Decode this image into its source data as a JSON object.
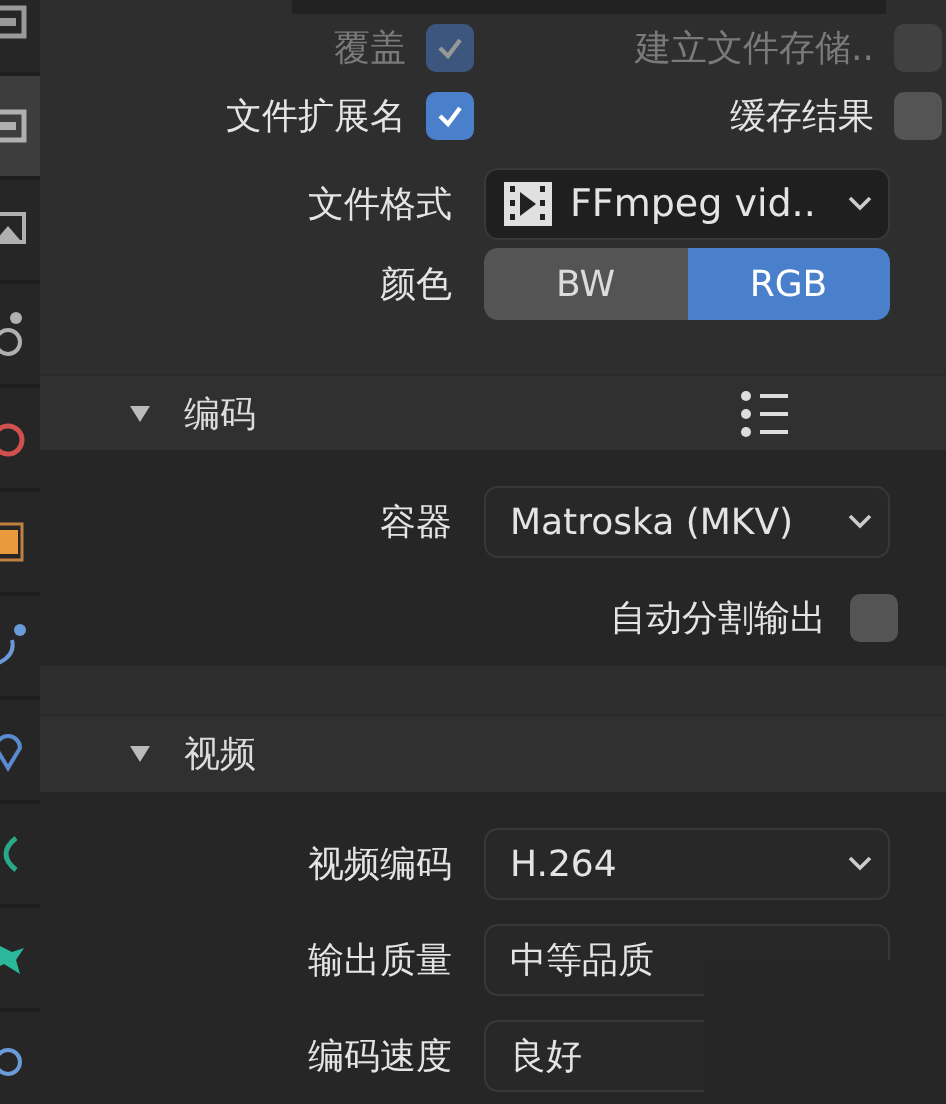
{
  "sidebar_tabs": [
    {
      "selected": false
    },
    {
      "selected": true
    },
    {
      "selected": false
    },
    {
      "selected": false
    },
    {
      "selected": false
    },
    {
      "selected": false
    },
    {
      "selected": false
    },
    {
      "selected": false
    },
    {
      "selected": false
    },
    {
      "selected": false
    },
    {
      "selected": false
    }
  ],
  "checkbox_rows": [
    [
      {
        "label": "覆盖",
        "checked": true,
        "disabled": true
      },
      {
        "label": "建立文件存储..",
        "checked": false,
        "disabled": true
      }
    ],
    [
      {
        "label": "文件扩展名",
        "checked": true,
        "disabled": false
      },
      {
        "label": "缓存结果",
        "checked": false,
        "disabled": false
      }
    ]
  ],
  "file_format": {
    "label": "文件格式",
    "value": "FFmpeg vid.."
  },
  "color": {
    "label": "颜色",
    "options": [
      {
        "label": "BW",
        "selected": false
      },
      {
        "label": "RGB",
        "selected": true
      }
    ]
  },
  "sections": [
    {
      "title": "编码",
      "expanded": true,
      "presets_menu": true,
      "fields": [
        {
          "kind": "dropdown",
          "label": "容器",
          "value": "Matroska (MKV)"
        },
        {
          "kind": "checkbox",
          "label": "自动分割输出",
          "checked": false
        }
      ]
    },
    {
      "title": "视频",
      "expanded": true,
      "presets_menu": false,
      "fields": [
        {
          "kind": "dropdown",
          "label": "视频编码",
          "value": "H.264"
        },
        {
          "kind": "field",
          "label": "输出质量",
          "value": "中等品质"
        },
        {
          "kind": "field",
          "label": "编码速度",
          "value": "良好"
        }
      ]
    }
  ]
}
